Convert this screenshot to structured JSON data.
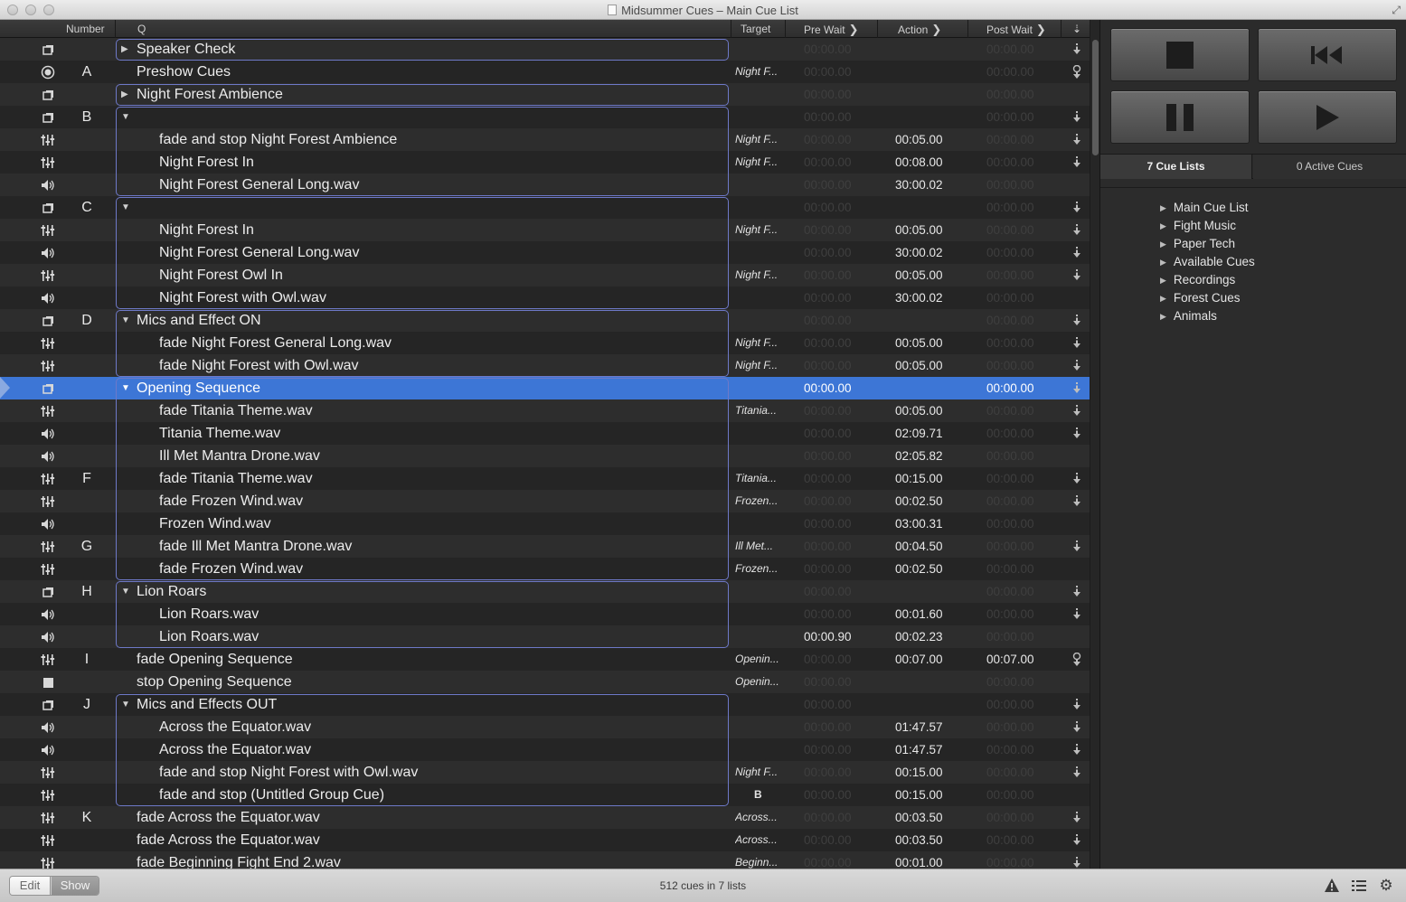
{
  "window": {
    "title": "Midsummer Cues – Main Cue List"
  },
  "table": {
    "headers": {
      "number": "Number",
      "q": "Q",
      "target": "Target",
      "pre_wait": "Pre Wait",
      "action": "Action",
      "post_wait": "Post Wait"
    },
    "rows": [
      {
        "type": "group",
        "number": "",
        "name": "Speaker Check",
        "level": 0,
        "tri": "right",
        "target": "",
        "pre": "00:00.00",
        "pre_lit": false,
        "action": "",
        "post": "00:00.00",
        "post_lit": false,
        "cont": "arrow-down"
      },
      {
        "type": "target-cue",
        "number": "A",
        "name": "Preshow Cues",
        "level": 0,
        "tri": "",
        "target": "Night F...",
        "pre": "00:00.00",
        "pre_lit": false,
        "action": "",
        "post": "00:00.00",
        "post_lit": false,
        "cont": "auto-follow"
      },
      {
        "type": "group",
        "number": "",
        "name": "Night Forest Ambience",
        "level": 0,
        "tri": "right",
        "target": "",
        "pre": "00:00.00",
        "pre_lit": false,
        "action": "",
        "post": "00:00.00",
        "post_lit": false,
        "cont": ""
      },
      {
        "type": "group",
        "number": "B",
        "name": "",
        "level": 0,
        "tri": "down",
        "target": "",
        "pre": "00:00.00",
        "pre_lit": false,
        "action": "",
        "post": "00:00.00",
        "post_lit": false,
        "cont": "arrow-down"
      },
      {
        "type": "fade",
        "number": "",
        "name": "fade and stop Night Forest Ambience",
        "level": 1,
        "tri": "",
        "target": "Night F...",
        "pre": "00:00.00",
        "pre_lit": false,
        "action": "00:05.00",
        "post": "00:00.00",
        "post_lit": false,
        "cont": "arrow-down"
      },
      {
        "type": "fade",
        "number": "",
        "name": "Night Forest In",
        "level": 1,
        "tri": "",
        "target": "Night F...",
        "pre": "00:00.00",
        "pre_lit": false,
        "action": "00:08.00",
        "post": "00:00.00",
        "post_lit": false,
        "cont": "arrow-down"
      },
      {
        "type": "audio",
        "number": "",
        "name": "Night Forest General Long.wav",
        "level": 1,
        "tri": "",
        "target": "",
        "pre": "00:00.00",
        "pre_lit": false,
        "action": "30:00.02",
        "post": "00:00.00",
        "post_lit": false,
        "cont": ""
      },
      {
        "type": "group",
        "number": "C",
        "name": "",
        "level": 0,
        "tri": "down",
        "target": "",
        "pre": "00:00.00",
        "pre_lit": false,
        "action": "",
        "post": "00:00.00",
        "post_lit": false,
        "cont": "arrow-down"
      },
      {
        "type": "fade",
        "number": "",
        "name": "Night Forest In",
        "level": 1,
        "tri": "",
        "target": "Night F...",
        "pre": "00:00.00",
        "pre_lit": false,
        "action": "00:05.00",
        "post": "00:00.00",
        "post_lit": false,
        "cont": "arrow-down"
      },
      {
        "type": "audio",
        "number": "",
        "name": "Night Forest General Long.wav",
        "level": 1,
        "tri": "",
        "target": "",
        "pre": "00:00.00",
        "pre_lit": false,
        "action": "30:00.02",
        "post": "00:00.00",
        "post_lit": false,
        "cont": "arrow-down"
      },
      {
        "type": "fade",
        "number": "",
        "name": "Night Forest Owl In",
        "level": 1,
        "tri": "",
        "target": "Night F...",
        "pre": "00:00.00",
        "pre_lit": false,
        "action": "00:05.00",
        "post": "00:00.00",
        "post_lit": false,
        "cont": "arrow-down"
      },
      {
        "type": "audio",
        "number": "",
        "name": "Night Forest with Owl.wav",
        "level": 1,
        "tri": "",
        "target": "",
        "pre": "00:00.00",
        "pre_lit": false,
        "action": "30:00.02",
        "post": "00:00.00",
        "post_lit": false,
        "cont": ""
      },
      {
        "type": "group",
        "number": "D",
        "name": "Mics and Effect ON",
        "level": 0,
        "tri": "down",
        "target": "",
        "pre": "00:00.00",
        "pre_lit": false,
        "action": "",
        "post": "00:00.00",
        "post_lit": false,
        "cont": "arrow-down"
      },
      {
        "type": "fade",
        "number": "",
        "name": "fade Night Forest General Long.wav",
        "level": 1,
        "tri": "",
        "target": "Night F...",
        "pre": "00:00.00",
        "pre_lit": false,
        "action": "00:05.00",
        "post": "00:00.00",
        "post_lit": false,
        "cont": "arrow-down"
      },
      {
        "type": "fade",
        "number": "",
        "name": "fade Night Forest with Owl.wav",
        "level": 1,
        "tri": "",
        "target": "Night F...",
        "pre": "00:00.00",
        "pre_lit": false,
        "action": "00:05.00",
        "post": "00:00.00",
        "post_lit": false,
        "cont": "arrow-down"
      },
      {
        "type": "group",
        "number": "",
        "name": "Opening Sequence",
        "level": 0,
        "tri": "down",
        "target": "",
        "pre": "00:00.00",
        "pre_lit": true,
        "action": "",
        "post": "00:00.00",
        "post_lit": true,
        "cont": "arrow-down",
        "selected": true
      },
      {
        "type": "fade",
        "number": "",
        "name": "fade Titania Theme.wav",
        "level": 1,
        "tri": "",
        "target": "Titania...",
        "pre": "00:00.00",
        "pre_lit": false,
        "action": "00:05.00",
        "post": "00:00.00",
        "post_lit": false,
        "cont": "arrow-down"
      },
      {
        "type": "audio",
        "number": "",
        "name": "Titania Theme.wav",
        "level": 1,
        "tri": "",
        "target": "",
        "pre": "00:00.00",
        "pre_lit": false,
        "action": "02:09.71",
        "post": "00:00.00",
        "post_lit": false,
        "cont": "arrow-down"
      },
      {
        "type": "audio",
        "number": "",
        "name": "Ill Met Mantra Drone.wav",
        "level": 1,
        "tri": "",
        "target": "",
        "pre": "00:00.00",
        "pre_lit": false,
        "action": "02:05.82",
        "post": "00:00.00",
        "post_lit": false,
        "cont": ""
      },
      {
        "type": "fade",
        "number": "F",
        "name": "fade Titania Theme.wav",
        "level": 1,
        "tri": "",
        "target": "Titania...",
        "pre": "00:00.00",
        "pre_lit": false,
        "action": "00:15.00",
        "post": "00:00.00",
        "post_lit": false,
        "cont": "arrow-down"
      },
      {
        "type": "fade",
        "number": "",
        "name": "fade Frozen Wind.wav",
        "level": 1,
        "tri": "",
        "target": "Frozen...",
        "pre": "00:00.00",
        "pre_lit": false,
        "action": "00:02.50",
        "post": "00:00.00",
        "post_lit": false,
        "cont": "arrow-down"
      },
      {
        "type": "audio",
        "number": "",
        "name": "Frozen Wind.wav",
        "level": 1,
        "tri": "",
        "target": "",
        "pre": "00:00.00",
        "pre_lit": false,
        "action": "03:00.31",
        "post": "00:00.00",
        "post_lit": false,
        "cont": ""
      },
      {
        "type": "fade",
        "number": "G",
        "name": "fade Ill Met Mantra Drone.wav",
        "level": 1,
        "tri": "",
        "target": "Ill Met...",
        "pre": "00:00.00",
        "pre_lit": false,
        "action": "00:04.50",
        "post": "00:00.00",
        "post_lit": false,
        "cont": "arrow-down"
      },
      {
        "type": "fade",
        "number": "",
        "name": "fade Frozen Wind.wav",
        "level": 1,
        "tri": "",
        "target": "Frozen...",
        "pre": "00:00.00",
        "pre_lit": false,
        "action": "00:02.50",
        "post": "00:00.00",
        "post_lit": false,
        "cont": ""
      },
      {
        "type": "group",
        "number": "H",
        "name": "Lion Roars",
        "level": 0,
        "tri": "down",
        "target": "",
        "pre": "00:00.00",
        "pre_lit": false,
        "action": "",
        "post": "00:00.00",
        "post_lit": false,
        "cont": "arrow-down"
      },
      {
        "type": "audio",
        "number": "",
        "name": "Lion Roars.wav",
        "level": 1,
        "tri": "",
        "target": "",
        "pre": "00:00.00",
        "pre_lit": false,
        "action": "00:01.60",
        "post": "00:00.00",
        "post_lit": false,
        "cont": "arrow-down"
      },
      {
        "type": "audio",
        "number": "",
        "name": "Lion Roars.wav",
        "level": 1,
        "tri": "",
        "target": "",
        "pre": "00:00.90",
        "pre_lit": true,
        "action": "00:02.23",
        "post": "00:00.00",
        "post_lit": false,
        "cont": ""
      },
      {
        "type": "fade",
        "number": "I",
        "name": "fade Opening Sequence",
        "level": 0,
        "tri": "",
        "target": "Openin...",
        "pre": "00:00.00",
        "pre_lit": false,
        "action": "00:07.00",
        "post": "00:07.00",
        "post_lit": true,
        "cont": "auto-follow"
      },
      {
        "type": "stop",
        "number": "",
        "name": "stop Opening Sequence",
        "level": 0,
        "tri": "",
        "target": "Openin...",
        "pre": "00:00.00",
        "pre_lit": false,
        "action": "",
        "post": "00:00.00",
        "post_lit": false,
        "cont": ""
      },
      {
        "type": "group",
        "number": "J",
        "name": "Mics and Effects OUT",
        "level": 0,
        "tri": "down",
        "target": "",
        "pre": "00:00.00",
        "pre_lit": false,
        "action": "",
        "post": "00:00.00",
        "post_lit": false,
        "cont": "arrow-down"
      },
      {
        "type": "audio",
        "number": "",
        "name": "Across the Equator.wav",
        "level": 1,
        "tri": "",
        "target": "",
        "pre": "00:00.00",
        "pre_lit": false,
        "action": "01:47.57",
        "post": "00:00.00",
        "post_lit": false,
        "cont": "arrow-down"
      },
      {
        "type": "audio",
        "number": "",
        "name": "Across the Equator.wav",
        "level": 1,
        "tri": "",
        "target": "",
        "pre": "00:00.00",
        "pre_lit": false,
        "action": "01:47.57",
        "post": "00:00.00",
        "post_lit": false,
        "cont": "arrow-down"
      },
      {
        "type": "fade",
        "number": "",
        "name": "fade and stop Night Forest with Owl.wav",
        "level": 1,
        "tri": "",
        "target": "Night F...",
        "pre": "00:00.00",
        "pre_lit": false,
        "action": "00:15.00",
        "post": "00:00.00",
        "post_lit": false,
        "cont": "arrow-down"
      },
      {
        "type": "fade",
        "number": "",
        "name": "fade and stop (Untitled Group Cue)",
        "level": 1,
        "tri": "",
        "target": "B",
        "pre": "00:00.00",
        "pre_lit": false,
        "action": "00:15.00",
        "post": "00:00.00",
        "post_lit": false,
        "cont": ""
      },
      {
        "type": "fade",
        "number": "K",
        "name": "fade Across the Equator.wav",
        "level": 0,
        "tri": "",
        "target": "Across...",
        "pre": "00:00.00",
        "pre_lit": false,
        "action": "00:03.50",
        "post": "00:00.00",
        "post_lit": false,
        "cont": "arrow-down"
      },
      {
        "type": "fade",
        "number": "",
        "name": "fade Across the Equator.wav",
        "level": 0,
        "tri": "",
        "target": "Across...",
        "pre": "00:00.00",
        "pre_lit": false,
        "action": "00:03.50",
        "post": "00:00.00",
        "post_lit": false,
        "cont": "arrow-down"
      },
      {
        "type": "fade",
        "number": "",
        "name": "fade Beginning Fight End 2.wav",
        "level": 0,
        "tri": "",
        "target": "Beginn...",
        "pre": "00:00.00",
        "pre_lit": false,
        "action": "00:01.00",
        "post": "00:00.00",
        "post_lit": false,
        "cont": "arrow-down"
      }
    ]
  },
  "transport": {
    "stop": "stop-icon",
    "rewind": "skip-back-icon",
    "pause": "pause-icon",
    "go": "play-icon"
  },
  "side_tabs": {
    "cue_lists": "7 Cue Lists",
    "active_cues": "0 Active Cues"
  },
  "cue_lists": [
    "Main Cue List",
    "Fight Music",
    "Paper Tech",
    "Available Cues",
    "Recordings",
    "Forest Cues",
    "Animals"
  ],
  "bottom": {
    "edit": "Edit",
    "show": "Show",
    "status": "512 cues in 7 lists",
    "icons": [
      "warning-icon",
      "list-icon",
      "gear-icon"
    ]
  },
  "colors": {
    "selection": "#3d76d6",
    "group_outline": "#6e79c8"
  }
}
